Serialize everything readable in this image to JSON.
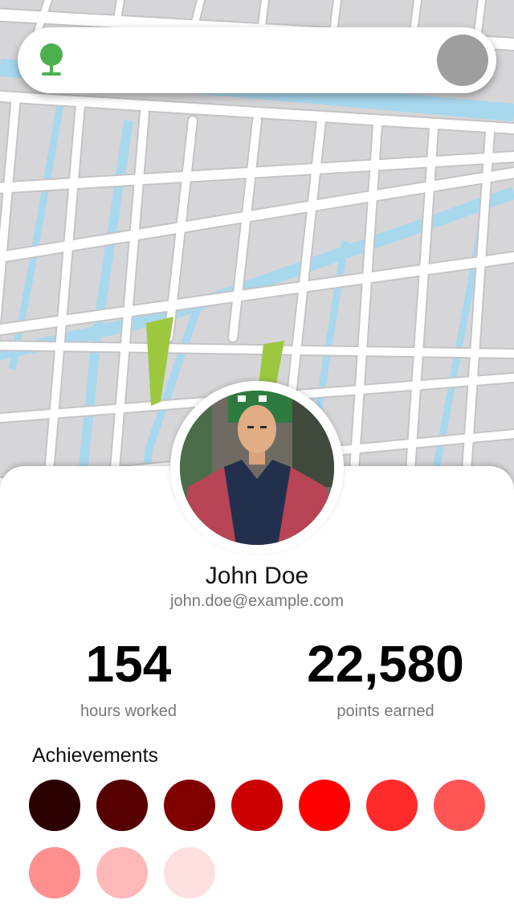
{
  "map": {
    "colors": {
      "land": "#d6d6d8",
      "street": "#ffffff",
      "street_casing": "#c4c4c6",
      "water": "#a8d8ee",
      "park": "#9cc840"
    }
  },
  "search_bar": {
    "tree_icon": "tree-icon",
    "tree_color": "#4caf50",
    "avatar_color": "#9e9e9e"
  },
  "profile": {
    "name": "John Doe",
    "email": "john.doe@example.com"
  },
  "stats": [
    {
      "value": "154",
      "label": "hours worked"
    },
    {
      "value": "22,580",
      "label": "points earned"
    }
  ],
  "achievements": {
    "title": "Achievements",
    "badge_colors": [
      "#2a0000",
      "#550000",
      "#800000",
      "#cc0000",
      "#ff0000",
      "#ff2a2a",
      "#ff5555",
      "#ff8f8f",
      "#ffb8b8",
      "#ffe0e0"
    ]
  }
}
